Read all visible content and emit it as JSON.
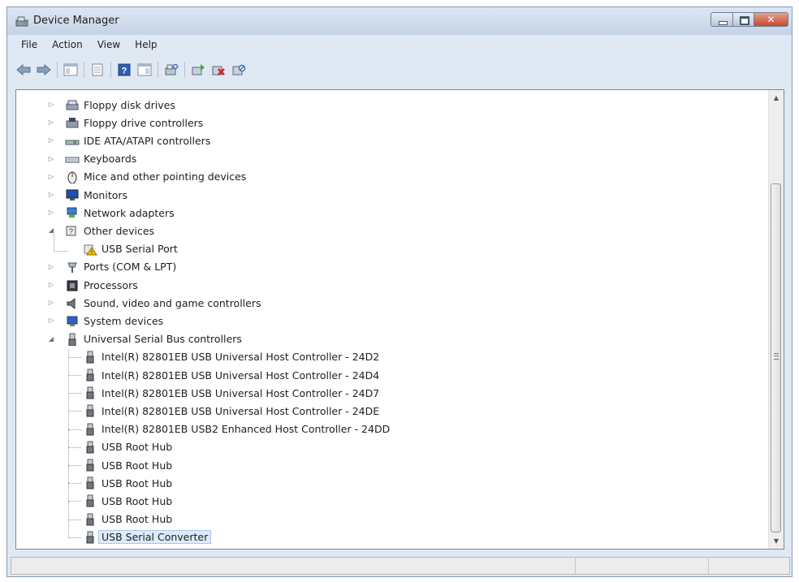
{
  "window": {
    "title": "Device Manager"
  },
  "menu": [
    "File",
    "Action",
    "View",
    "Help"
  ],
  "toolbar": {
    "icons": [
      "back-arrow-icon",
      "forward-arrow-icon",
      "show-hide-console-tree-icon",
      "properties-sheet-icon",
      "help-icon",
      "show-action-pane-icon",
      "scan-hardware-icon",
      "update-driver-icon",
      "uninstall-device-icon",
      "disable-device-icon"
    ]
  },
  "tree": {
    "categories": [
      {
        "label": "Floppy disk drives",
        "icon": "floppy-drive-icon"
      },
      {
        "label": "Floppy drive controllers",
        "icon": "floppy-controller-icon"
      },
      {
        "label": "IDE ATA/ATAPI controllers",
        "icon": "ide-controller-icon"
      },
      {
        "label": "Keyboards",
        "icon": "keyboard-icon"
      },
      {
        "label": "Mice and other pointing devices",
        "icon": "mouse-icon"
      },
      {
        "label": "Monitors",
        "icon": "monitor-icon"
      },
      {
        "label": "Network adapters",
        "icon": "network-adapter-icon"
      },
      {
        "label": "Other devices",
        "icon": "other-devices-icon"
      },
      {
        "label": "USB Serial Port",
        "icon": "warning-device-icon"
      },
      {
        "label": "Ports (COM & LPT)",
        "icon": "ports-icon"
      },
      {
        "label": "Processors",
        "icon": "processor-icon"
      },
      {
        "label": "Sound, video and game controllers",
        "icon": "sound-controller-icon"
      },
      {
        "label": "System devices",
        "icon": "system-devices-icon"
      },
      {
        "label": "Universal Serial Bus controllers",
        "icon": "usb-controller-icon"
      }
    ],
    "usb_children": [
      "Intel(R) 82801EB USB Universal Host Controller - 24D2",
      "Intel(R) 82801EB USB Universal Host Controller - 24D4",
      "Intel(R) 82801EB USB Universal Host Controller - 24D7",
      "Intel(R) 82801EB USB Universal Host Controller - 24DE",
      "Intel(R) 82801EB USB2 Enhanced Host Controller - 24DD",
      "USB Root Hub",
      "USB Root Hub",
      "USB Root Hub",
      "USB Root Hub",
      "USB Root Hub",
      "USB Serial Converter"
    ],
    "selected": "USB Serial Converter"
  },
  "colors": {
    "selection_bg": "#dcebfc",
    "titlebar": "#c5d3e6",
    "close_button": "#c44a2e"
  }
}
